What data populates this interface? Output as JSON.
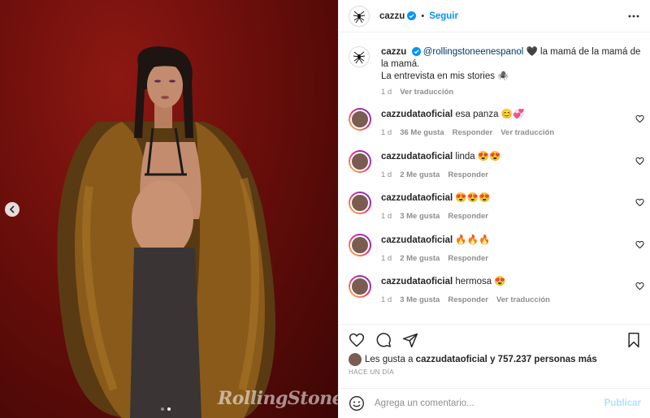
{
  "post": {
    "author": "cazzu",
    "follow_label": "Seguir",
    "separator": "•",
    "caption": {
      "author": "cazzu",
      "mention": "@rollingstoneenespanol",
      "text_line1": " 🖤 la mamá de la mamá de la mamá.",
      "text_line2": "La entrevista en mis stories 🕷️",
      "time": "1 d",
      "translate": "Ver traducción"
    },
    "watermark": "RollingStone",
    "photo_dots": {
      "count": 2,
      "active_index": 1
    }
  },
  "comments": [
    {
      "user": "cazzudataoficial",
      "text": "esa panza 😊💞",
      "time": "1 d",
      "likes": "36 Me gusta",
      "reply": "Responder",
      "translate": "Ver traducción"
    },
    {
      "user": "cazzudataoficial",
      "text": "linda 😍😍",
      "time": "1 d",
      "likes": "2 Me gusta",
      "reply": "Responder",
      "translate": ""
    },
    {
      "user": "cazzudataoficial",
      "text": "😍😍😍",
      "time": "1 d",
      "likes": "3 Me gusta",
      "reply": "Responder",
      "translate": ""
    },
    {
      "user": "cazzudataoficial",
      "text": "🔥🔥🔥",
      "time": "1 d",
      "likes": "2 Me gusta",
      "reply": "Responder",
      "translate": ""
    },
    {
      "user": "cazzudataoficial",
      "text": "hermosa 😍",
      "time": "1 d",
      "likes": "3 Me gusta",
      "reply": "Responder",
      "translate": "Ver traducción"
    }
  ],
  "actions": {
    "likes_prefix": "Les gusta a",
    "likes_user": "cazzudataoficial",
    "likes_suffix": "y 757.237 personas más",
    "posted_ago": "HACE UN DÍA"
  },
  "add_comment": {
    "placeholder": "Agrega un comentario...",
    "publish": "Publicar"
  },
  "colors": {
    "accent": "#0095f6",
    "publish_disabled": "#b2dffc",
    "muted": "#8e8e8e"
  }
}
